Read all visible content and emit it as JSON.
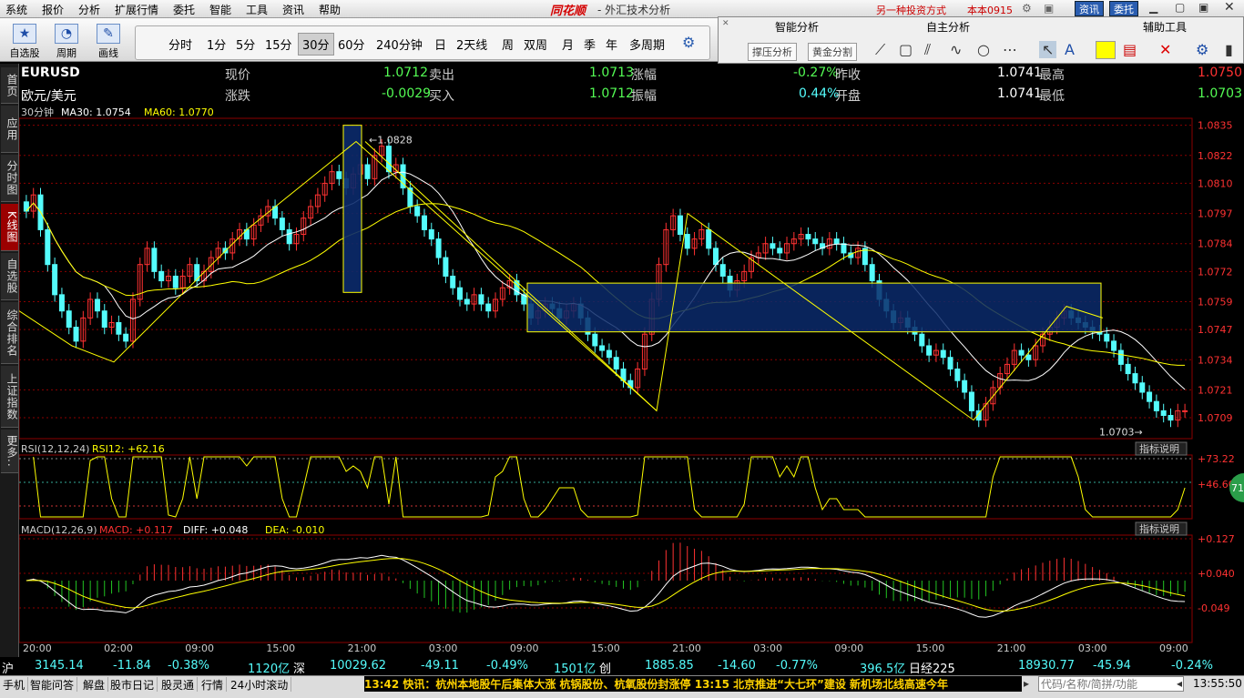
{
  "menu": {
    "items": [
      "系统",
      "报价",
      "分析",
      "扩展行情",
      "委托",
      "智能",
      "工具",
      "资讯",
      "帮助"
    ],
    "brand": "同花顺",
    "app_title": "- 外汇技术分析",
    "promo": "另一种投资方式",
    "user": "本本0915",
    "btn_news": "资讯",
    "btn_trade": "委托"
  },
  "toolbar": {
    "tools": [
      {
        "label": "自选股",
        "icon": "★"
      },
      {
        "label": "周期",
        "icon": "◔"
      },
      {
        "label": "画线",
        "icon": "✎"
      }
    ],
    "periods": [
      "分时",
      "1分",
      "5分",
      "15分",
      "30分",
      "60分",
      "240分钟",
      "日",
      "2天线",
      "周",
      "双周",
      "月",
      "季",
      "年",
      "多周期"
    ],
    "active_period": "30分"
  },
  "right_panel": {
    "headers": [
      "智能分析",
      "自主分析",
      "辅助工具"
    ],
    "buttons": [
      "撑压分析",
      "黄金分割"
    ],
    "accent": "#ffff00"
  },
  "left_tabs": [
    {
      "label": "首页",
      "active": false
    },
    {
      "label": "应用",
      "active": false
    },
    {
      "label": "分时图",
      "active": false
    },
    {
      "label": "K线图",
      "active": true
    },
    {
      "label": "自选股",
      "active": false
    },
    {
      "label": "综合排名",
      "active": false
    },
    {
      "label": "上证指数",
      "active": false
    },
    {
      "label": "更多..",
      "active": false
    }
  ],
  "quote": {
    "symbol": "EURUSD",
    "name": "欧元/美元",
    "rows": [
      [
        {
          "k": "现价",
          "v": "1.0712"
        },
        {
          "k": "卖出",
          "v": "1.0713"
        },
        {
          "k": "涨幅",
          "v": "-0.27%"
        },
        {
          "k": "昨收",
          "v": "1.0741"
        },
        {
          "k": "最高",
          "v": "1.0750"
        }
      ],
      [
        {
          "k": "涨跌",
          "v": "-0.0029"
        },
        {
          "k": "买入",
          "v": "1.0712"
        },
        {
          "k": "振幅",
          "v": "0.44%"
        },
        {
          "k": "开盘",
          "v": "1.0741"
        },
        {
          "k": "最低",
          "v": "1.0703"
        }
      ]
    ]
  },
  "indicators": {
    "main": {
      "period": "30分钟",
      "ma30": "MA30: 1.0754",
      "ma60": "MA60: 1.0770"
    },
    "rsi": {
      "label": "RSI(12,12,24)",
      "value": "RSI12: +62.16",
      "explain": "指标说明"
    },
    "macd": {
      "label": "MACD(12,26,9)",
      "macd": "MACD: +0.117",
      "diff": "DIFF: +0.048",
      "dea": "DEA: -0.010",
      "explain": "指标说明"
    }
  },
  "chart_data": {
    "type": "candlestick",
    "price_axis": [
      1.0835,
      1.0822,
      1.081,
      1.0797,
      1.0784,
      1.0772,
      1.0759,
      1.0747,
      1.0734,
      1.0721,
      1.0709
    ],
    "rsi_axis": [
      "+73.22",
      "+46.60"
    ],
    "macd_axis": [
      "+0.127",
      "+0.040",
      "-0.049"
    ],
    "time_axis": [
      "20:00",
      "02:00",
      "09:00",
      "15:00",
      "21:00",
      "03:00",
      "09:00",
      "15:00",
      "21:00",
      "03:00",
      "09:00",
      "15:00",
      "21:00",
      "03:00",
      "09:00"
    ],
    "high_label": "1.0828",
    "low_label": "1.0703",
    "rsi_badge": "71",
    "colors": {
      "up": "#ff3232",
      "down": "#54fcfc",
      "ma30": "#ffffff",
      "ma60": "#ffff00",
      "grid": "#8b0000"
    },
    "closes": [
      1.0798,
      1.0805,
      1.079,
      1.0775,
      1.0762,
      1.0755,
      1.0748,
      1.0742,
      1.0752,
      1.076,
      1.0755,
      1.0748,
      1.075,
      1.0745,
      1.0742,
      1.076,
      1.0775,
      1.0782,
      1.0772,
      1.0768,
      1.077,
      1.0765,
      1.077,
      1.0775,
      1.0768,
      1.0772,
      1.0778,
      1.0782,
      1.078,
      1.0786,
      1.079,
      1.0786,
      1.0792,
      1.0796,
      1.08,
      1.0795,
      1.079,
      1.0784,
      1.0788,
      1.0795,
      1.08,
      1.0805,
      1.081,
      1.0815,
      1.0812,
      1.0808,
      1.0814,
      1.0818,
      1.0812,
      1.0822,
      1.0826,
      1.0815,
      1.0818,
      1.0808,
      1.08,
      1.0796,
      1.079,
      1.0786,
      1.0778,
      1.077,
      1.0765,
      1.076,
      1.0758,
      1.0762,
      1.0758,
      1.0755,
      1.076,
      1.0765,
      1.0768,
      1.0762,
      1.0758,
      1.0752,
      1.0755,
      1.0758,
      1.0756,
      1.0752,
      1.0755,
      1.0758,
      1.0752,
      1.0745,
      1.074,
      1.0738,
      1.0735,
      1.073,
      1.0725,
      1.0722,
      1.073,
      1.0745,
      1.076,
      1.0775,
      1.079,
      1.0796,
      1.0788,
      1.0782,
      1.0786,
      1.079,
      1.0782,
      1.0775,
      1.077,
      1.0764,
      1.0768,
      1.0772,
      1.0778,
      1.078,
      1.0784,
      1.0782,
      1.078,
      1.0784,
      1.0786,
      1.0788,
      1.0786,
      1.0784,
      1.0782,
      1.0786,
      1.0784,
      1.078,
      1.0778,
      1.0782,
      1.0775,
      1.0768,
      1.076,
      1.0755,
      1.075,
      1.0752,
      1.0748,
      1.0745,
      1.074,
      1.0736,
      1.0738,
      1.0735,
      1.073,
      1.0725,
      1.072,
      1.0712,
      1.0708,
      1.0715,
      1.0722,
      1.0728,
      1.0732,
      1.0738,
      1.0736,
      1.0734,
      1.074,
      1.0745,
      1.0748,
      1.0752,
      1.0755,
      1.0752,
      1.075,
      1.0748,
      1.0746,
      1.0745,
      1.0742,
      1.0738,
      1.0732,
      1.0728,
      1.0724,
      1.072,
      1.0716,
      1.0712,
      1.071,
      1.0708,
      1.0712,
      1.0712
    ]
  },
  "status": {
    "items": [
      {
        "t": "沪",
        "c": "#ffffff"
      },
      {
        "t": "3145.14",
        "c": "#54fcfc"
      },
      {
        "t": "-11.84",
        "c": "#54fcfc"
      },
      {
        "t": "-0.38%",
        "c": "#54fcfc"
      },
      {
        "t": "1120亿",
        "c": "#54fcfc"
      },
      {
        "t": "深",
        "c": "#ffffff"
      },
      {
        "t": "10029.62",
        "c": "#54fcfc"
      },
      {
        "t": "-49.11",
        "c": "#54fcfc"
      },
      {
        "t": "-0.49%",
        "c": "#54fcfc"
      },
      {
        "t": "1501亿",
        "c": "#54fcfc"
      },
      {
        "t": "创",
        "c": "#ffffff"
      },
      {
        "t": "1885.85",
        "c": "#54fcfc"
      },
      {
        "t": "-14.60",
        "c": "#54fcfc"
      },
      {
        "t": "-0.77%",
        "c": "#54fcfc"
      },
      {
        "t": "396.5亿",
        "c": "#54fcfc"
      },
      {
        "t": "日经225",
        "c": "#ffffff"
      },
      {
        "t": "18930.77",
        "c": "#54fcfc"
      },
      {
        "t": "-45.94",
        "c": "#54fcfc"
      },
      {
        "t": "-0.24%",
        "c": "#54fcfc"
      }
    ]
  },
  "bottom": {
    "tabs": [
      "手机",
      "智能问答",
      "解盘",
      "股市日记",
      "股灵通",
      "行情",
      "24小时滚动"
    ],
    "ticker": "13:42 快讯：杭州本地股午后集体大涨 杭锅股份、杭氧股份封涨停      13:15 北京推进“大七环”建设 新机场北线高速今年",
    "search_placeholder": "代码/名称/简拼/功能",
    "clock": "13:55:50"
  }
}
